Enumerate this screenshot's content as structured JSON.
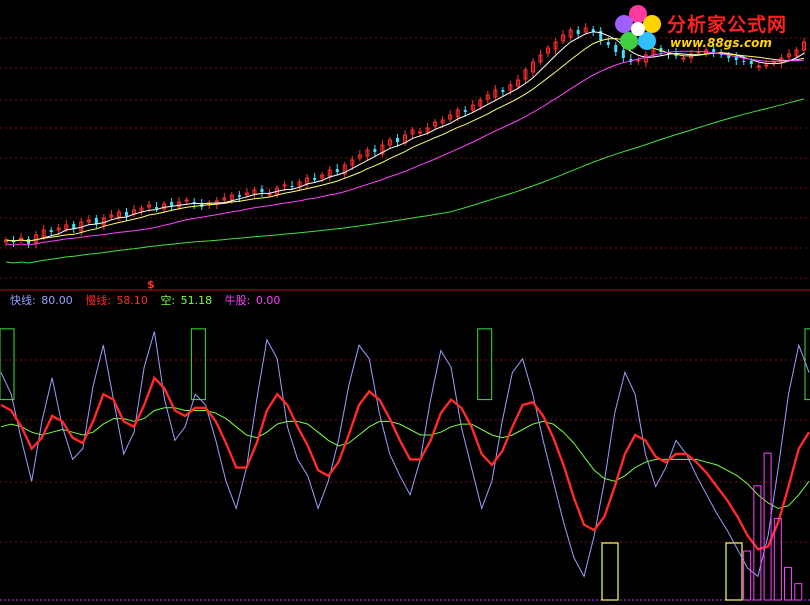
{
  "logo": {
    "name": "分析家公式网",
    "url": "www.88gs.com"
  },
  "marker": "$",
  "legend": [
    {
      "label": "快线:",
      "value": "80.00",
      "color": "#9aa0ff"
    },
    {
      "label": "慢线:",
      "value": "58.10",
      "color": "#ff2a2a"
    },
    {
      "label": "空:",
      "value": "51.18",
      "color": "#7cff3a"
    },
    {
      "label": "牛股:",
      "value": "0.00",
      "color": "#ff40ff"
    }
  ],
  "chart_data": [
    {
      "type": "candlestick",
      "series": [
        {
          "name": "price",
          "values": [
            300,
            298,
            302,
            296,
            305,
            310,
            308,
            312,
            315,
            311,
            318,
            320,
            316,
            322,
            325,
            328,
            324,
            330,
            332,
            335,
            331,
            336,
            334,
            338,
            340,
            336,
            333,
            337,
            339,
            342,
            345,
            343,
            347,
            350,
            348,
            346,
            352,
            355,
            353,
            358,
            362,
            360,
            365,
            370,
            368,
            375,
            380,
            385,
            390,
            388,
            395,
            400,
            398,
            405,
            410,
            408,
            412,
            418,
            420,
            425,
            430,
            428,
            435,
            440,
            445,
            450,
            448,
            455,
            460,
            470,
            478,
            485,
            492,
            498,
            505,
            510,
            506,
            512,
            508,
            500,
            495,
            488,
            482,
            478,
            480,
            485,
            490,
            488,
            486,
            484,
            482,
            486,
            488,
            490,
            488,
            485,
            482,
            480,
            478,
            476,
            474,
            475,
            478,
            482,
            486,
            490,
            498
          ]
        },
        {
          "name": "ma_fast",
          "color": "#ffffff"
        },
        {
          "name": "ma_mid",
          "color": "#ffff66"
        },
        {
          "name": "ma_slow",
          "color": "#ff40ff"
        },
        {
          "name": "ma_long",
          "color": "#40e040"
        }
      ]
    },
    {
      "type": "line",
      "series": [
        {
          "name": "快线",
          "color": "#9aa0ff",
          "values": [
            80,
            72,
            55,
            40,
            62,
            78,
            60,
            48,
            52,
            75,
            90,
            70,
            50,
            58,
            82,
            95,
            70,
            55,
            60,
            72,
            68,
            55,
            40,
            30,
            45,
            70,
            92,
            85,
            60,
            48,
            42,
            30,
            40,
            55,
            75,
            90,
            85,
            65,
            50,
            42,
            35,
            48,
            70,
            88,
            82,
            60,
            45,
            30,
            40,
            62,
            80,
            85,
            72,
            55,
            40,
            25,
            12,
            5,
            20,
            40,
            65,
            80,
            72,
            50,
            38,
            45,
            55,
            50,
            42,
            35,
            28,
            22,
            15,
            8,
            5,
            20,
            45,
            72,
            90,
            80
          ]
        },
        {
          "name": "慢线",
          "color": "#ff2a2a",
          "values": [
            68,
            66,
            60,
            52,
            56,
            64,
            62,
            56,
            54,
            62,
            72,
            70,
            62,
            60,
            68,
            78,
            74,
            66,
            64,
            67,
            67,
            62,
            54,
            45,
            45,
            54,
            66,
            72,
            68,
            60,
            53,
            44,
            42,
            47,
            57,
            68,
            73,
            70,
            63,
            55,
            48,
            48,
            55,
            65,
            70,
            67,
            60,
            50,
            46,
            51,
            60,
            68,
            69,
            64,
            56,
            46,
            34,
            24,
            22,
            27,
            38,
            50,
            57,
            55,
            49,
            47,
            50,
            50,
            47,
            43,
            38,
            33,
            27,
            20,
            15,
            16,
            25,
            38,
            52,
            58
          ]
        },
        {
          "name": "空",
          "color": "#7cff3a",
          "values": [
            60,
            61,
            60,
            58,
            57,
            58,
            59,
            58,
            57,
            58,
            61,
            63,
            63,
            62,
            63,
            66,
            67,
            67,
            66,
            66,
            66,
            65,
            63,
            60,
            57,
            56,
            58,
            61,
            62,
            62,
            61,
            58,
            55,
            53,
            54,
            57,
            60,
            62,
            62,
            61,
            59,
            57,
            57,
            58,
            60,
            61,
            61,
            59,
            57,
            56,
            57,
            59,
            61,
            62,
            61,
            58,
            54,
            49,
            44,
            41,
            40,
            42,
            45,
            47,
            48,
            48,
            48,
            48,
            48,
            47,
            46,
            44,
            42,
            39,
            35,
            32,
            30,
            31,
            35,
            40
          ]
        },
        {
          "name": "牛股",
          "color": "#ff40ff",
          "values": [
            0,
            0,
            0,
            0,
            0,
            0,
            0,
            0,
            0,
            0,
            0,
            0,
            0,
            0,
            0,
            0,
            0,
            0,
            0,
            0,
            0,
            0,
            0,
            0,
            0,
            0,
            0,
            0,
            0,
            0,
            0,
            0,
            0,
            0,
            0,
            0,
            0,
            0,
            0,
            0,
            0,
            0,
            0,
            0,
            0,
            0,
            0,
            0,
            0,
            0,
            0,
            0,
            0,
            0,
            0,
            0,
            0,
            0,
            0,
            0,
            0,
            0,
            0,
            0,
            0,
            0,
            0,
            0,
            0,
            0,
            0,
            0,
            0,
            6,
            14,
            18,
            10,
            4,
            2,
            0
          ]
        }
      ],
      "ylim": [
        0,
        100
      ]
    }
  ]
}
